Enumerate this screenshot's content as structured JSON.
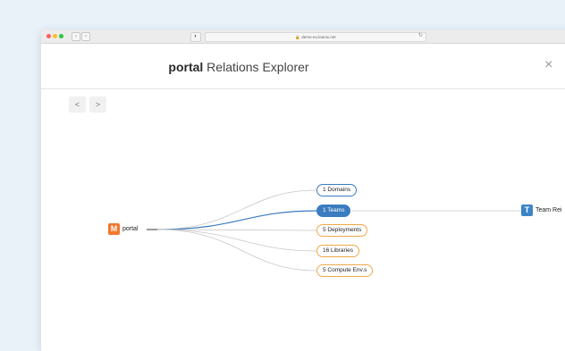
{
  "browser": {
    "url": "demo-eu.leanix.net",
    "shield_icon": "shield-icon",
    "reload_icon": "reload-icon"
  },
  "header": {
    "brand": "portal",
    "title_rest": " Relations Explorer",
    "close_label": "×"
  },
  "pager": {
    "prev_label": "<",
    "next_label": ">"
  },
  "graph": {
    "root": {
      "icon_letter": "M",
      "label": "portal"
    },
    "relations": [
      {
        "label": "1 Domains"
      },
      {
        "label": "1 Teams"
      },
      {
        "label": "5 Deployments"
      },
      {
        "label": "16 Libraries"
      },
      {
        "label": "5 Compute Env.s"
      }
    ],
    "team": {
      "icon_letter": "T",
      "label": "Team Rei"
    }
  },
  "colors": {
    "accent_blue": "#3b7bbf",
    "accent_orange": "#f0a848",
    "root_icon": "#f0772d"
  }
}
